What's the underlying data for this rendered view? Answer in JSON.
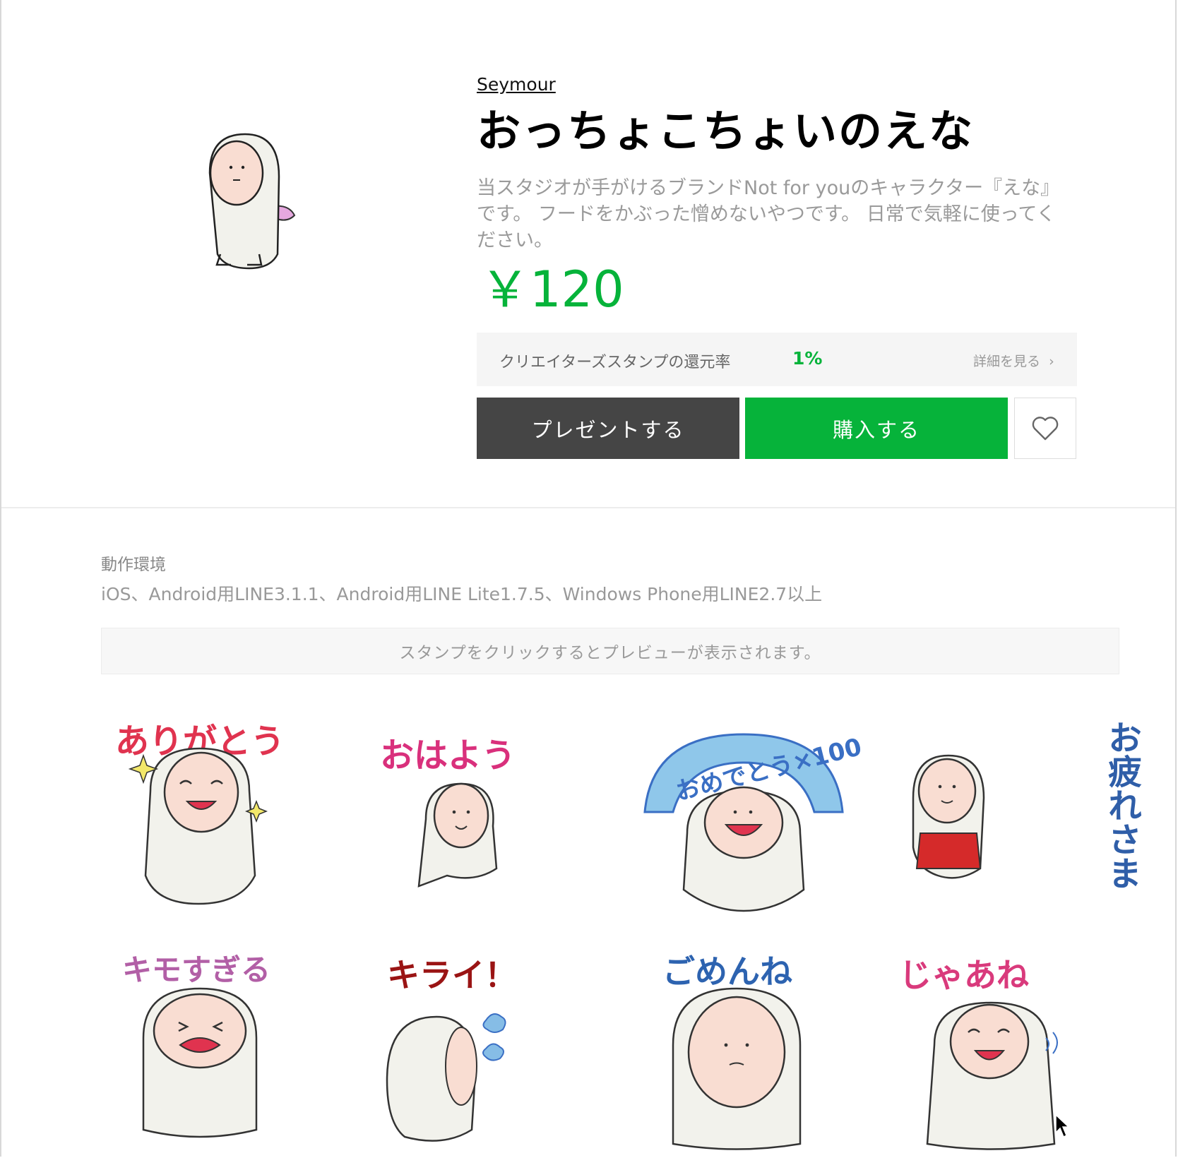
{
  "product": {
    "author": "Seymour",
    "title": "おっちょこちょいのえな",
    "description": "当スタジオが手がけるブランドNot for youのキャラクター『えな』です。 フードをかぶった憎めないやつです。 日常で気軽に使ってください。",
    "price": "￥120"
  },
  "rate": {
    "label": "クリエイターズスタンプの還元率",
    "value": "1%",
    "link": "詳細を見る"
  },
  "buttons": {
    "gift": "プレゼントする",
    "buy": "購入する",
    "favorite_icon": "heart-outline-icon"
  },
  "environment": {
    "label": "動作環境",
    "text": "iOS、Android用LINE3.1.1、Android用LINE Lite1.7.5、Windows Phone用LINE2.7以上"
  },
  "notice": "スタンプをクリックするとプレビューが表示されます。",
  "stickers": [
    {
      "caption": "ありがとう",
      "color": "#e0334f"
    },
    {
      "caption": "おはよう",
      "color": "#d9307c"
    },
    {
      "caption": "おめでとう×100",
      "color": "#3a6fc4"
    },
    {
      "caption": "お疲れさま",
      "color": "#2f5ea8"
    },
    {
      "caption": "キモすぎる",
      "color": "#b25fa6"
    },
    {
      "caption": "キライ！",
      "color": "#9a1414"
    },
    {
      "caption": "ごめんね",
      "color": "#2d63b0"
    },
    {
      "caption": "じゃあね",
      "color": "#d93a7c"
    }
  ],
  "colors": {
    "accent_green": "#06b33a",
    "dark_button": "#454545"
  }
}
